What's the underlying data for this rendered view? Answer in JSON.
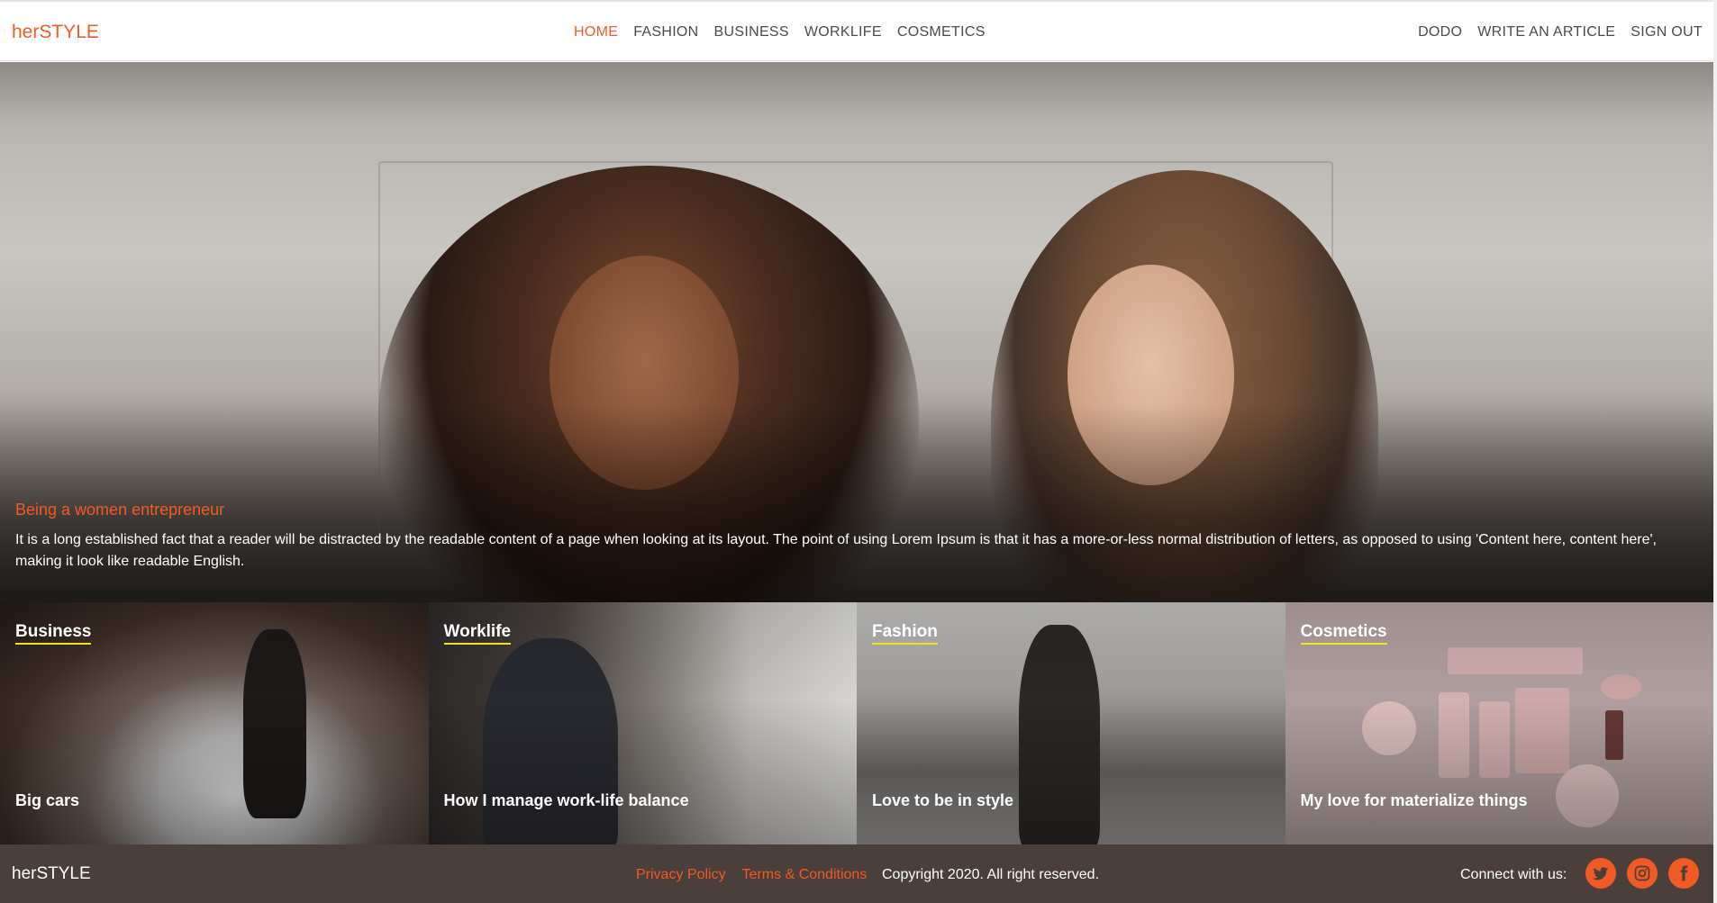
{
  "nav": {
    "brand": "herSTYLE",
    "main": [
      {
        "label": "HOME",
        "active": true
      },
      {
        "label": "FASHION"
      },
      {
        "label": "BUSINESS"
      },
      {
        "label": "WORKLIFE"
      },
      {
        "label": "COSMETICS"
      }
    ],
    "user": [
      {
        "label": "DODO"
      },
      {
        "label": "WRITE AN ARTICLE"
      },
      {
        "label": "SIGN OUT"
      }
    ]
  },
  "hero": {
    "title": "Being a women entrepreneur",
    "text": "It is a long established fact that a reader will be distracted by the readable content of a page when looking at its layout. The point of using Lorem Ipsum is that it has a more-or-less normal distribution of letters, as opposed to using 'Content here, content here', making it look like readable English."
  },
  "cards": [
    {
      "category": "Business",
      "headline": "Big cars"
    },
    {
      "category": "Worklife",
      "headline": "How I manage work-life balance"
    },
    {
      "category": "Fashion",
      "headline": "Love to be in style"
    },
    {
      "category": "Cosmetics",
      "headline": "My love for materialize things"
    }
  ],
  "footer": {
    "brand": "herSTYLE",
    "links": [
      "Privacy Policy",
      "Terms & Conditions"
    ],
    "copyright": "Copyright 2020. All right reserved.",
    "connect_label": "Connect with us:",
    "social_icons": [
      "twitter-icon",
      "instagram-icon",
      "facebook-icon"
    ]
  },
  "colors": {
    "accent": "#f15a24",
    "underline": "#f4e11d",
    "footer_bg": "#4a3f3a"
  }
}
